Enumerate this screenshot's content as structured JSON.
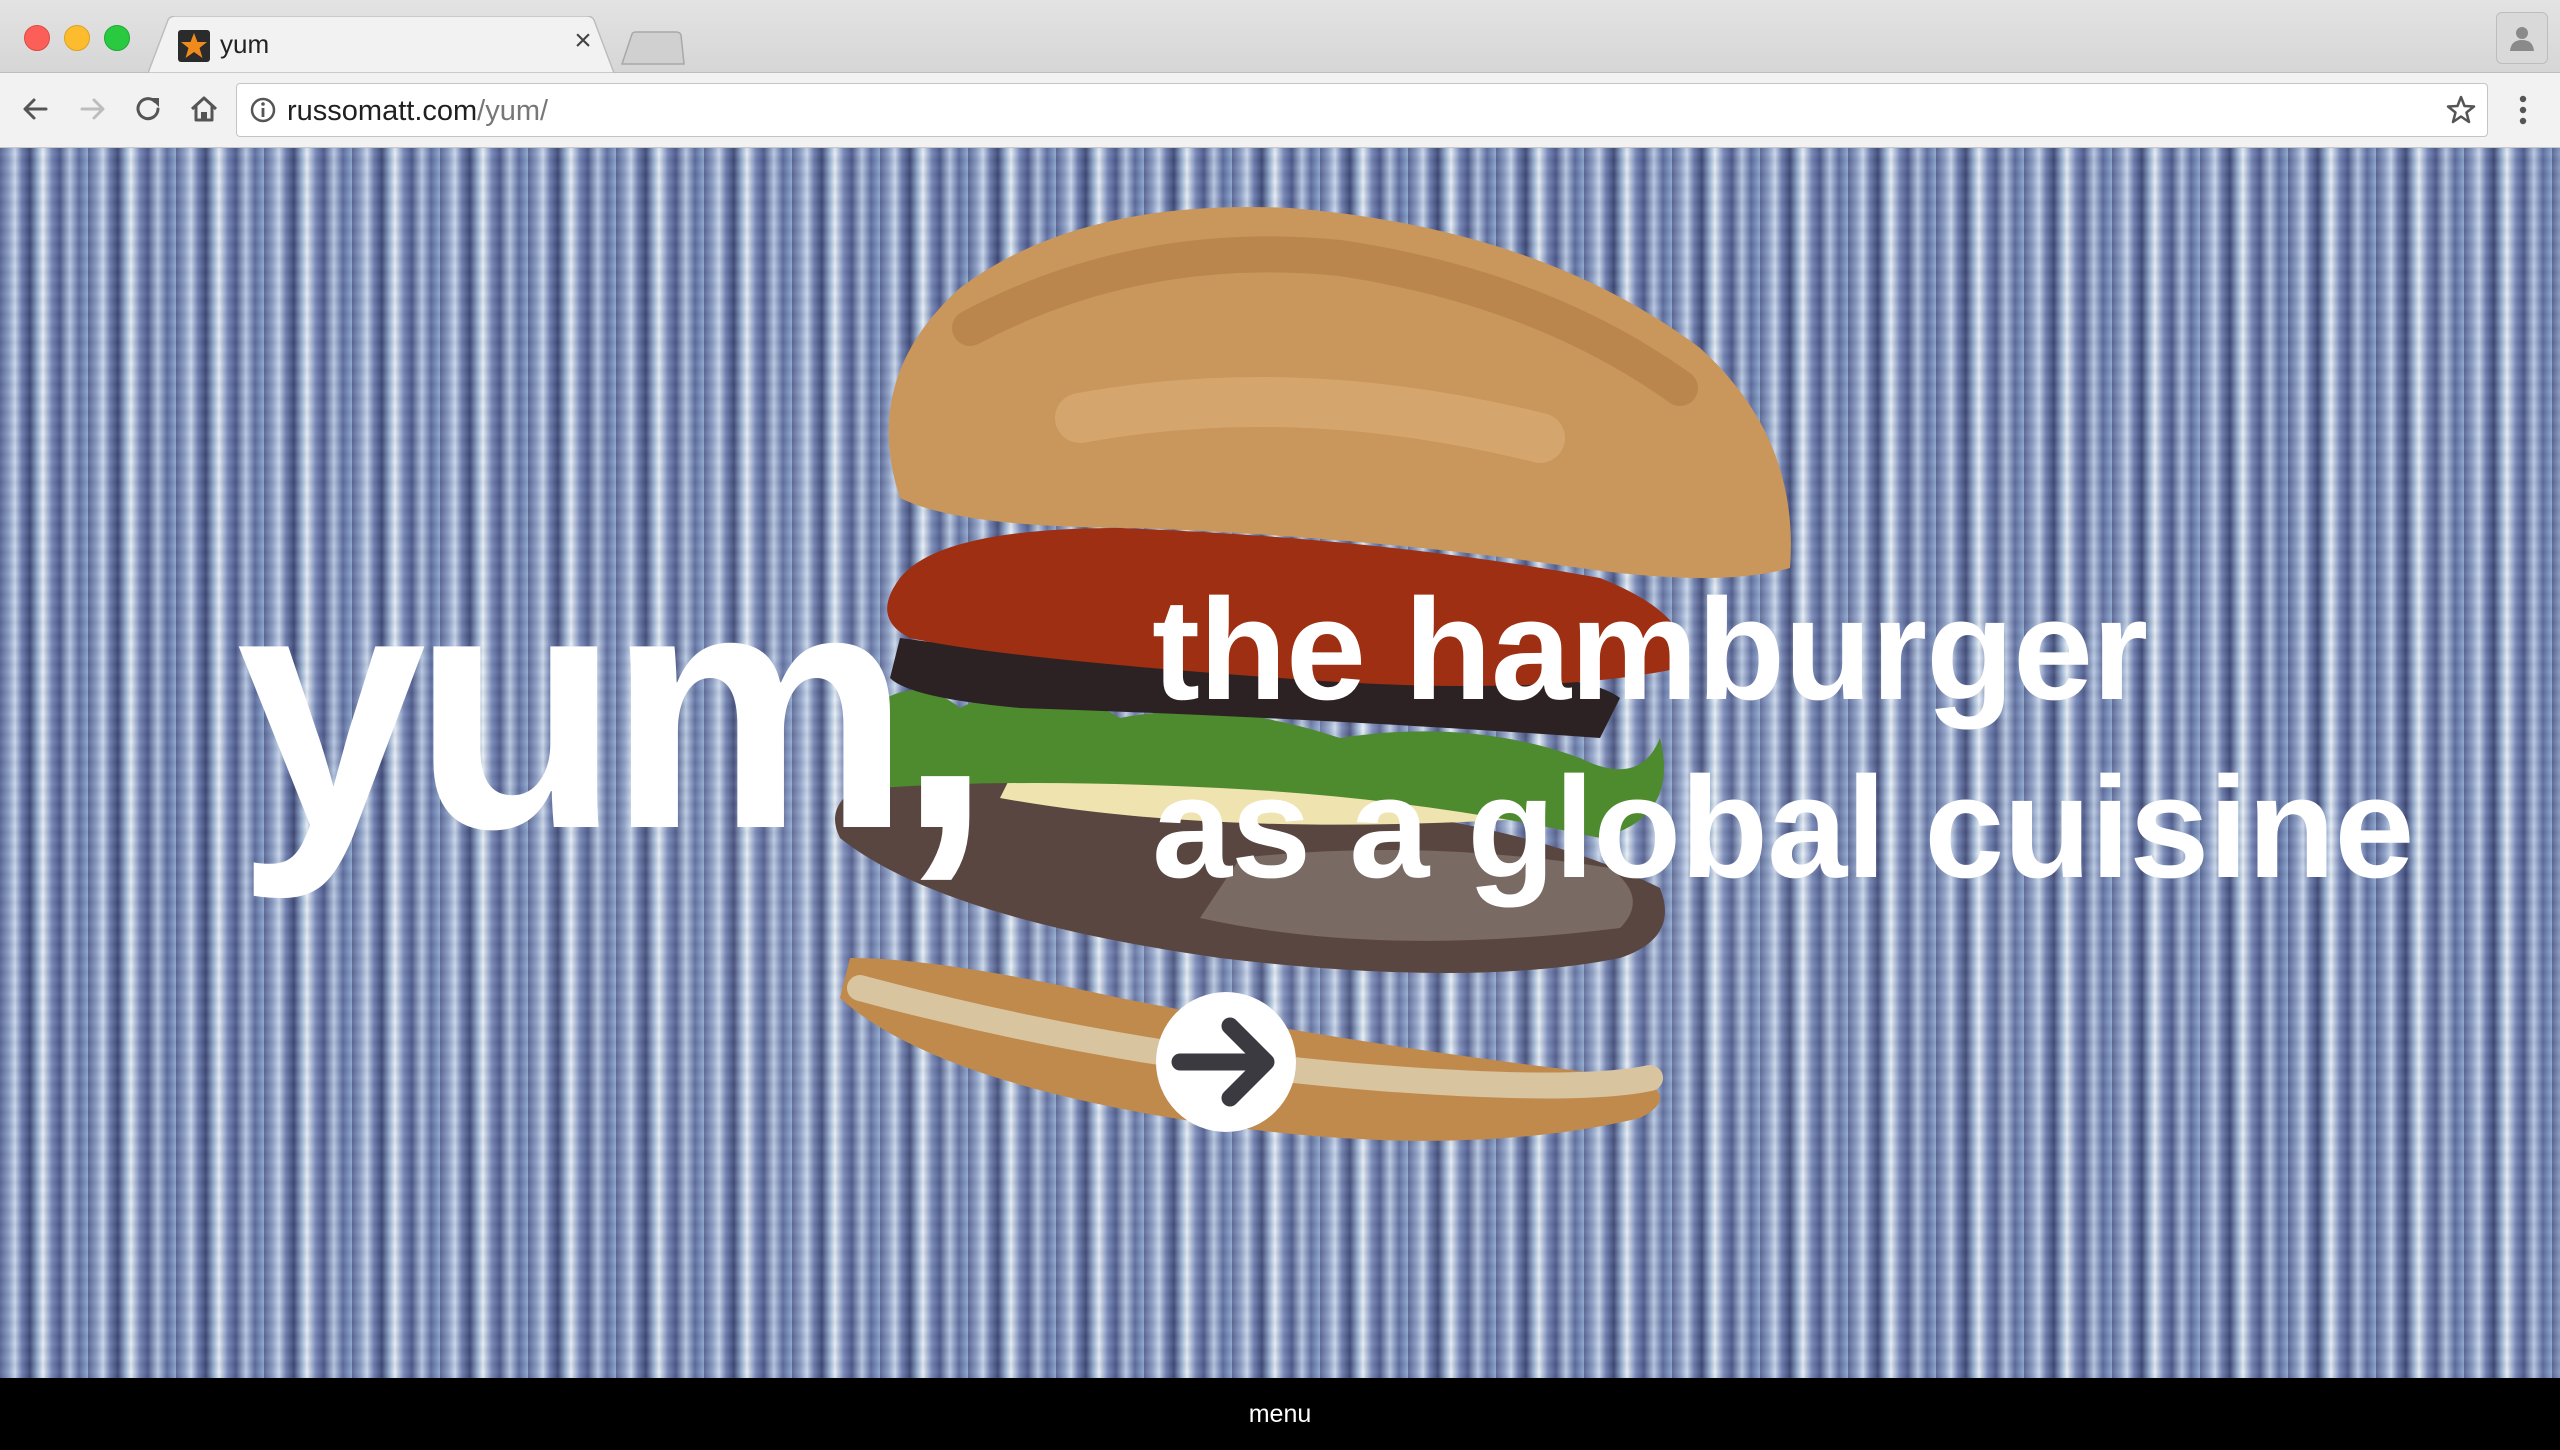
{
  "browser": {
    "tab": {
      "title": "yum",
      "favicon": "star-favicon",
      "close_symbol": "×"
    },
    "address_bar": {
      "url_host": "russomatt.com",
      "url_path": "/yum/"
    },
    "icons": {
      "back": "back-arrow-icon",
      "forward": "forward-arrow-icon",
      "reload": "reload-icon",
      "home": "home-icon",
      "info": "info-icon",
      "bookmark": "star-icon",
      "menu": "kebab-menu-icon",
      "profile": "profile-icon"
    }
  },
  "hero": {
    "title": "yum,",
    "subtitle_line1": "the hamburger",
    "subtitle_line2": "as a global cuisine",
    "next_icon": "arrow-right-icon"
  },
  "footer": {
    "menu_label": "menu"
  },
  "colors": {
    "text": "#ffffff",
    "footer_bg": "#000000",
    "favicon_star": "#f08a1c"
  }
}
